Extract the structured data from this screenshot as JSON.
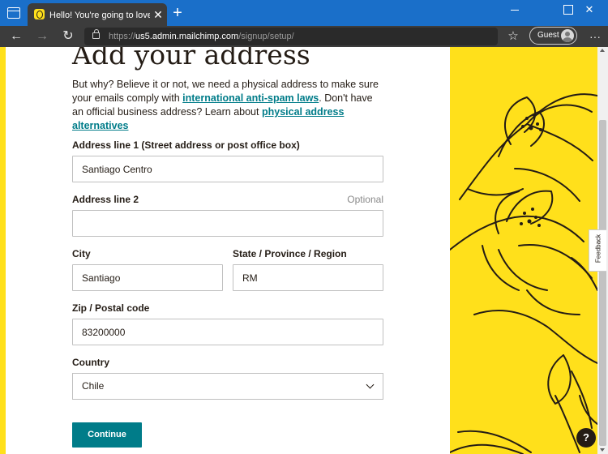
{
  "browser": {
    "tab_title": "Hello! You're going to love it here",
    "tab_close": "✕",
    "new_tab": "+",
    "url_scheme": "https://",
    "url_host": "us5.admin.mailchimp.com",
    "url_path": "/signup/setup/",
    "profile_label": "Guest",
    "more_menu": "···",
    "back": "←",
    "forward": "→",
    "reload": "↻",
    "favorites": "☆"
  },
  "page": {
    "heading": "Add your address",
    "intro_part1": "But why? Believe it or not, we need a physical address to make sure your emails comply with ",
    "intro_link1": "international anti-spam laws",
    "intro_part2": ". Don't have an official business address? Learn about ",
    "intro_link2": "physical address alternatives"
  },
  "form": {
    "address1": {
      "label": "Address line 1 (Street address or post office box)",
      "value": "Santiago Centro"
    },
    "address2": {
      "label": "Address line 2",
      "optional": "Optional",
      "value": ""
    },
    "city": {
      "label": "City",
      "value": "Santiago"
    },
    "state": {
      "label": "State / Province / Region",
      "value": "RM"
    },
    "zip": {
      "label": "Zip / Postal code",
      "value": "83200000"
    },
    "country": {
      "label": "Country",
      "value": "Chile"
    },
    "continue_label": "Continue"
  },
  "widgets": {
    "feedback_label": "Feedback",
    "help_label": "?"
  },
  "colors": {
    "accent_teal": "#007c89",
    "brand_yellow": "#ffe01b",
    "ink": "#241c15",
    "titlebar_blue": "#1a6fc9"
  }
}
